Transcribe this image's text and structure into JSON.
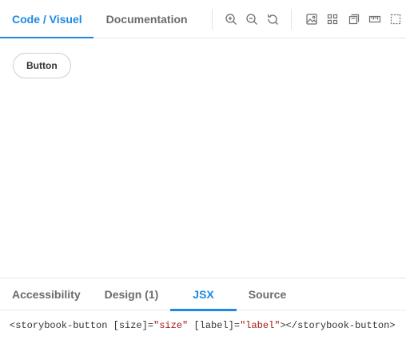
{
  "top_tabs": [
    {
      "label": "Code / Visuel",
      "active": true
    },
    {
      "label": "Documentation",
      "active": false
    }
  ],
  "toolbar": {
    "icons": [
      "zoom-in-icon",
      "zoom-out-icon",
      "reset-zoom-icon",
      "image-background-icon",
      "grid-icon",
      "viewport-icon",
      "measure-ruler-icon",
      "outline-icon"
    ]
  },
  "preview": {
    "button_label": "Button"
  },
  "bottom_tabs": [
    {
      "label": "Accessibility",
      "active": false
    },
    {
      "label": "Design (1)",
      "active": false
    },
    {
      "label": "JSX",
      "active": true
    },
    {
      "label": "Source",
      "active": false
    }
  ],
  "code": {
    "part1": "<storybook-button [size]=",
    "part2": "\"size\"",
    "part3": " [label]=",
    "part4": "\"label\"",
    "part5": "></storybook-button>"
  },
  "colors": {
    "accent": "#1e88e5",
    "string": "#a31515",
    "muted_text": "#6b6b6b"
  }
}
